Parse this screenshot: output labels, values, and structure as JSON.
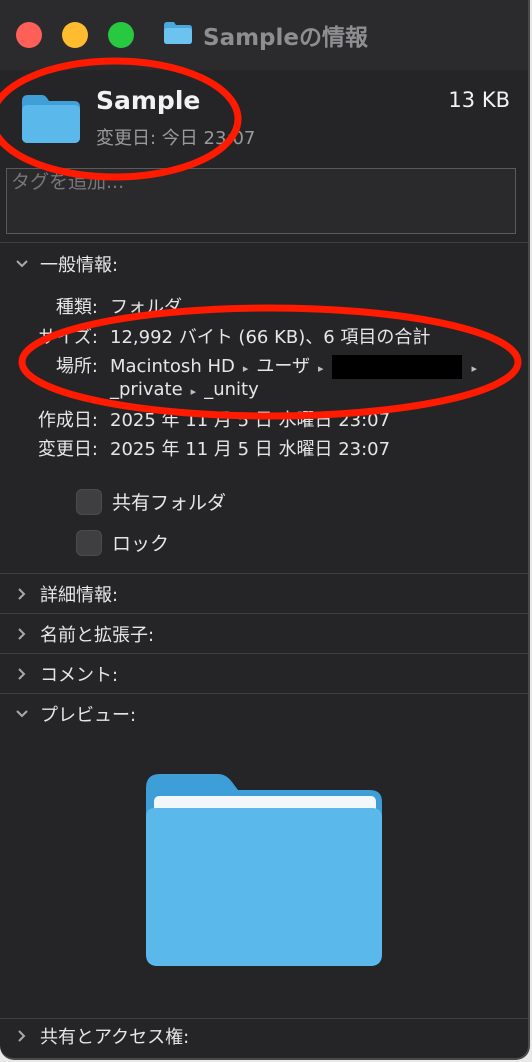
{
  "window": {
    "title": "Sampleの情報",
    "traffic_lights": [
      "close",
      "minimize",
      "zoom"
    ]
  },
  "header": {
    "name": "Sample",
    "size": "13 KB",
    "modified_label": "変更日: 今日 23:07",
    "icon": "folder-icon"
  },
  "tags": {
    "placeholder": "タグを追加..."
  },
  "general": {
    "heading": "一般情報:",
    "rows": {
      "kind": {
        "label": "種類:",
        "value": "フォルダ"
      },
      "size": {
        "label": "サイズ:",
        "value": "12,992 バイト (66 KB)、6 項目の合計"
      },
      "where": {
        "label": "場所:",
        "path1": "Macintosh HD",
        "path2": "ユーザ",
        "path4": "_private",
        "path5": "_unity"
      },
      "created": {
        "label": "作成日:",
        "value": "2025 年 11 月 5 日 水曜日 23:07"
      },
      "modified": {
        "label": "変更日:",
        "value": "2025 年 11 月 5 日 水曜日 23:07"
      }
    },
    "checkboxes": {
      "shared": {
        "label": "共有フォルダ",
        "checked": false
      },
      "locked": {
        "label": "ロック",
        "checked": false
      }
    }
  },
  "sections": {
    "more_info": "詳細情報:",
    "name_extension": "名前と拡張子:",
    "comments": "コメント:",
    "preview": "プレビュー:",
    "sharing": "共有とアクセス権:"
  },
  "colors": {
    "window_bg": "#252528",
    "folder_blue": "#5ab9ea",
    "annotation_red": "#ff1a00"
  }
}
